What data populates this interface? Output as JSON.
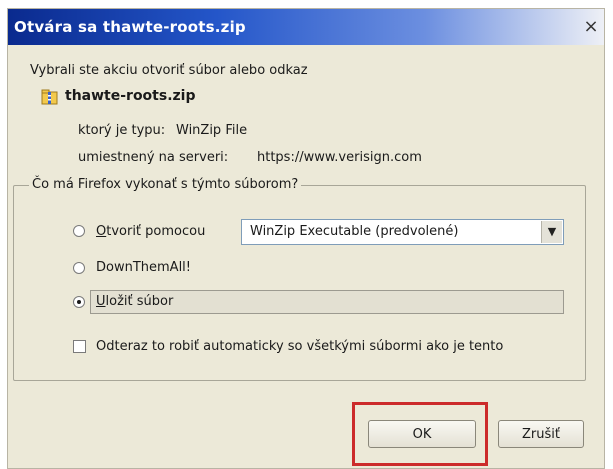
{
  "dialog": {
    "title": "Otvára sa thawte-roots.zip",
    "close_label": "×",
    "intro": "Vybrali ste akciu otvoriť súbor alebo odkaz",
    "filename": "thawte-roots.zip",
    "type_label": "ktorý je typu:",
    "type_value": "WinZip File",
    "server_label": "umiestnený na serveri:",
    "server_value": "https://www.verisign.com",
    "group_legend": "Čo má Firefox vykonať s týmto súborom?",
    "option_open": {
      "accel": "O",
      "rest": "tvoriť pomocou"
    },
    "open_with_value": "WinZip Executable (predvolené)",
    "option_downthemall": "DownThemAll!",
    "option_save": {
      "accel": "U",
      "rest": "ložiť súbor"
    },
    "checkbox_label": "Odteraz to robiť automaticky so všetkými súbormi ako je tento",
    "ok_label": "OK",
    "cancel_label": "Zrušiť",
    "selected_option": "save"
  },
  "colors": {
    "highlight": "#cc2b2b",
    "titlebar_start": "#0a2a8e"
  },
  "icons": {
    "file_icon": "winzip-file-icon",
    "dropdown": "chevron-down-icon",
    "close": "close-icon"
  }
}
